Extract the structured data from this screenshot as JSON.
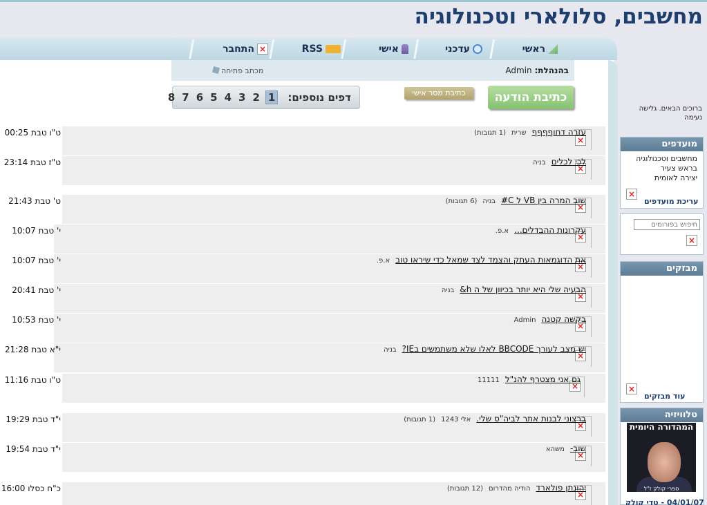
{
  "site": {
    "title": "מחשבים, סלולארי וטכנולוגיה"
  },
  "nav": {
    "tabs": [
      {
        "label": "ראשי",
        "icon": "home-icon"
      },
      {
        "label": "עדכני",
        "icon": "clock-icon"
      },
      {
        "label": "אישי",
        "icon": "user-icon"
      },
      {
        "label": "RSS",
        "icon": "rss-icon"
      },
      {
        "label": "התחבר",
        "icon": "broken-image-icon"
      }
    ]
  },
  "subbar": {
    "admin_label": "בהנהלת:",
    "admin_name": "Admin",
    "opening_letter": "מכתב פתיחה"
  },
  "actions": {
    "write_post": "כתיבת הודעה",
    "write_pm": "כתיבת מסר אישי"
  },
  "pagination": {
    "label": "דפים נוספים:",
    "pages": [
      "1",
      "2",
      "3",
      "4",
      "5",
      "6",
      "7",
      "8"
    ],
    "current": "1"
  },
  "topics": [
    {
      "title": "עזרה דחוףףףף",
      "author": "שרית",
      "replies": "(1 תגובות)",
      "date": "ט\"ו טבת 00:25"
    },
    {
      "title": "לכי לכלים",
      "author": "בניה",
      "replies": "",
      "date": "ט\"ז טבת 23:14"
    },
    {
      "title": "שוב המרה בין VB ל C#",
      "author": "בניה",
      "replies": "(6 תגובות)",
      "date": "ט' טבת 21:43"
    },
    {
      "title": "עקרונות ההבדלים...",
      "author": "א.פ.",
      "replies": "",
      "date": "י' טבת 10:07"
    },
    {
      "title": "את הדוגמאות העתק והצמד לצד שמאל כדי שיראו טוב",
      "author": "א.פ.",
      "replies": "",
      "date": "י' טבת 10:07"
    },
    {
      "title": "הבעיה שלי היא יותר בכיוון של ה h&",
      "author": "בניה",
      "replies": "",
      "date": "י' טבת 20:41"
    },
    {
      "title": "בקשה קטנה",
      "author": "Admin",
      "replies": "",
      "date": "י' טבת 10:53"
    },
    {
      "title": "יש מצב לעורך BBCODE לאלו שלא משתמשים בIE?",
      "author": "בניה",
      "replies": "",
      "date": "י\"א טבת 21:28"
    },
    {
      "title": "גם אני מצטרף להנ\"ל",
      "author": "11111",
      "replies": "",
      "date": "ט\"ו טבת 11:16"
    },
    {
      "title": "ברצוני לבנות אתר לביה\"ס שלי.",
      "author": "אלי 1243",
      "replies": "(1 תגובות)",
      "date": "י\"ד טבת 19:29"
    },
    {
      "title": "שוב-",
      "author": "משהא",
      "replies": "",
      "date": "י\"ד טבת 19:54"
    },
    {
      "title": "יהונתן פולארד",
      "author": "הודיה מהדרום",
      "replies": "(12 תגובות)",
      "date": "כ\"ח כסלו 16:00"
    }
  ],
  "sidebar": {
    "welcome": "ברוכים הבאים. גלישה נעימה",
    "favorites": {
      "title": "מועדפים",
      "items": [
        "מחשבים וטכנולוגיה",
        "בראש צעיר",
        "יצירה לאומית"
      ],
      "edit_link": "עריכת מועדפים"
    },
    "search": {
      "placeholder": "חיפוש בפורומים"
    },
    "visitors": {
      "title": "מבזקים",
      "more_link": "עוד מבזקים"
    },
    "tv": {
      "title": "טלוויזיה",
      "banner": "המהדורה היומית",
      "caption": "ספרי קולק ז\"ל",
      "date_line": "04/01/07 - טדי קולק"
    }
  },
  "colors": {
    "title": "#1d3e6e",
    "post_button": "#85c270",
    "pm_button": "#b3a46d",
    "side_header": "#5d7d96"
  }
}
